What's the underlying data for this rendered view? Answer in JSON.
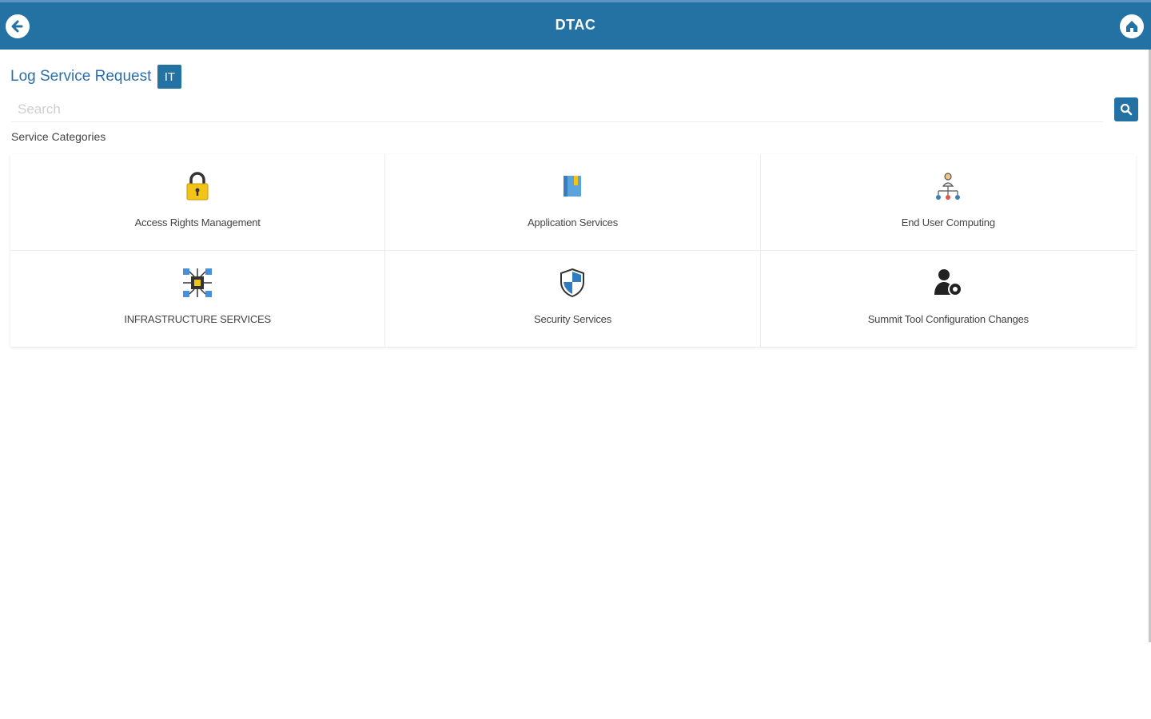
{
  "app": {
    "title": "DTAC"
  },
  "nav": {
    "back_icon": "back-arrow-icon",
    "home_icon": "home-icon"
  },
  "page": {
    "title": "Log Service Request",
    "badge": "IT"
  },
  "search": {
    "placeholder": "Search",
    "value": ""
  },
  "section": {
    "label": "Service Categories"
  },
  "categories": [
    {
      "label": "Access Rights Management",
      "icon": "padlock-icon"
    },
    {
      "label": "Application Services",
      "icon": "book-icon"
    },
    {
      "label": "End User Computing",
      "icon": "org-network-icon"
    },
    {
      "label": "INFRASTRUCTURE SERVICES",
      "icon": "circuit-chip-icon"
    },
    {
      "label": "Security Services",
      "icon": "shield-icon"
    },
    {
      "label": "Summit Tool Configuration Changes",
      "icon": "user-settings-icon"
    }
  ],
  "colors": {
    "primary": "#2471a3",
    "page_title": "#2f6fa6",
    "lock": "#f2c417"
  }
}
